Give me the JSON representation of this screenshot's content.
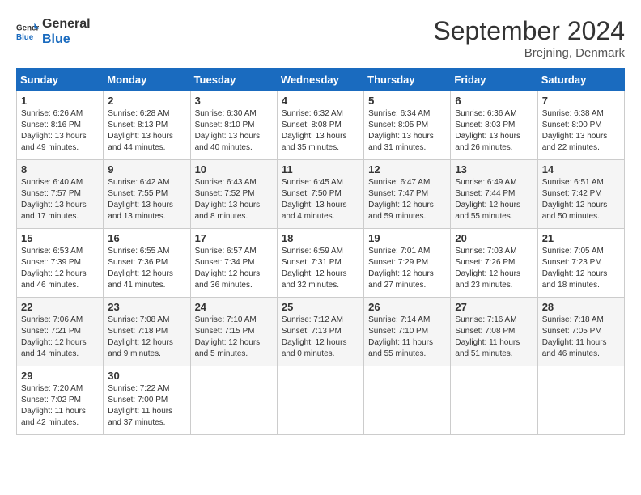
{
  "header": {
    "logo_line1": "General",
    "logo_line2": "Blue",
    "month_title": "September 2024",
    "location": "Brejning, Denmark"
  },
  "days_of_week": [
    "Sunday",
    "Monday",
    "Tuesday",
    "Wednesday",
    "Thursday",
    "Friday",
    "Saturday"
  ],
  "weeks": [
    [
      {
        "day": 1,
        "lines": [
          "Sunrise: 6:26 AM",
          "Sunset: 8:16 PM",
          "Daylight: 13 hours",
          "and 49 minutes."
        ]
      },
      {
        "day": 2,
        "lines": [
          "Sunrise: 6:28 AM",
          "Sunset: 8:13 PM",
          "Daylight: 13 hours",
          "and 44 minutes."
        ]
      },
      {
        "day": 3,
        "lines": [
          "Sunrise: 6:30 AM",
          "Sunset: 8:10 PM",
          "Daylight: 13 hours",
          "and 40 minutes."
        ]
      },
      {
        "day": 4,
        "lines": [
          "Sunrise: 6:32 AM",
          "Sunset: 8:08 PM",
          "Daylight: 13 hours",
          "and 35 minutes."
        ]
      },
      {
        "day": 5,
        "lines": [
          "Sunrise: 6:34 AM",
          "Sunset: 8:05 PM",
          "Daylight: 13 hours",
          "and 31 minutes."
        ]
      },
      {
        "day": 6,
        "lines": [
          "Sunrise: 6:36 AM",
          "Sunset: 8:03 PM",
          "Daylight: 13 hours",
          "and 26 minutes."
        ]
      },
      {
        "day": 7,
        "lines": [
          "Sunrise: 6:38 AM",
          "Sunset: 8:00 PM",
          "Daylight: 13 hours",
          "and 22 minutes."
        ]
      }
    ],
    [
      {
        "day": 8,
        "lines": [
          "Sunrise: 6:40 AM",
          "Sunset: 7:57 PM",
          "Daylight: 13 hours",
          "and 17 minutes."
        ]
      },
      {
        "day": 9,
        "lines": [
          "Sunrise: 6:42 AM",
          "Sunset: 7:55 PM",
          "Daylight: 13 hours",
          "and 13 minutes."
        ]
      },
      {
        "day": 10,
        "lines": [
          "Sunrise: 6:43 AM",
          "Sunset: 7:52 PM",
          "Daylight: 13 hours",
          "and 8 minutes."
        ]
      },
      {
        "day": 11,
        "lines": [
          "Sunrise: 6:45 AM",
          "Sunset: 7:50 PM",
          "Daylight: 13 hours",
          "and 4 minutes."
        ]
      },
      {
        "day": 12,
        "lines": [
          "Sunrise: 6:47 AM",
          "Sunset: 7:47 PM",
          "Daylight: 12 hours",
          "and 59 minutes."
        ]
      },
      {
        "day": 13,
        "lines": [
          "Sunrise: 6:49 AM",
          "Sunset: 7:44 PM",
          "Daylight: 12 hours",
          "and 55 minutes."
        ]
      },
      {
        "day": 14,
        "lines": [
          "Sunrise: 6:51 AM",
          "Sunset: 7:42 PM",
          "Daylight: 12 hours",
          "and 50 minutes."
        ]
      }
    ],
    [
      {
        "day": 15,
        "lines": [
          "Sunrise: 6:53 AM",
          "Sunset: 7:39 PM",
          "Daylight: 12 hours",
          "and 46 minutes."
        ]
      },
      {
        "day": 16,
        "lines": [
          "Sunrise: 6:55 AM",
          "Sunset: 7:36 PM",
          "Daylight: 12 hours",
          "and 41 minutes."
        ]
      },
      {
        "day": 17,
        "lines": [
          "Sunrise: 6:57 AM",
          "Sunset: 7:34 PM",
          "Daylight: 12 hours",
          "and 36 minutes."
        ]
      },
      {
        "day": 18,
        "lines": [
          "Sunrise: 6:59 AM",
          "Sunset: 7:31 PM",
          "Daylight: 12 hours",
          "and 32 minutes."
        ]
      },
      {
        "day": 19,
        "lines": [
          "Sunrise: 7:01 AM",
          "Sunset: 7:29 PM",
          "Daylight: 12 hours",
          "and 27 minutes."
        ]
      },
      {
        "day": 20,
        "lines": [
          "Sunrise: 7:03 AM",
          "Sunset: 7:26 PM",
          "Daylight: 12 hours",
          "and 23 minutes."
        ]
      },
      {
        "day": 21,
        "lines": [
          "Sunrise: 7:05 AM",
          "Sunset: 7:23 PM",
          "Daylight: 12 hours",
          "and 18 minutes."
        ]
      }
    ],
    [
      {
        "day": 22,
        "lines": [
          "Sunrise: 7:06 AM",
          "Sunset: 7:21 PM",
          "Daylight: 12 hours",
          "and 14 minutes."
        ]
      },
      {
        "day": 23,
        "lines": [
          "Sunrise: 7:08 AM",
          "Sunset: 7:18 PM",
          "Daylight: 12 hours",
          "and 9 minutes."
        ]
      },
      {
        "day": 24,
        "lines": [
          "Sunrise: 7:10 AM",
          "Sunset: 7:15 PM",
          "Daylight: 12 hours",
          "and 5 minutes."
        ]
      },
      {
        "day": 25,
        "lines": [
          "Sunrise: 7:12 AM",
          "Sunset: 7:13 PM",
          "Daylight: 12 hours",
          "and 0 minutes."
        ]
      },
      {
        "day": 26,
        "lines": [
          "Sunrise: 7:14 AM",
          "Sunset: 7:10 PM",
          "Daylight: 11 hours",
          "and 55 minutes."
        ]
      },
      {
        "day": 27,
        "lines": [
          "Sunrise: 7:16 AM",
          "Sunset: 7:08 PM",
          "Daylight: 11 hours",
          "and 51 minutes."
        ]
      },
      {
        "day": 28,
        "lines": [
          "Sunrise: 7:18 AM",
          "Sunset: 7:05 PM",
          "Daylight: 11 hours",
          "and 46 minutes."
        ]
      }
    ],
    [
      {
        "day": 29,
        "lines": [
          "Sunrise: 7:20 AM",
          "Sunset: 7:02 PM",
          "Daylight: 11 hours",
          "and 42 minutes."
        ]
      },
      {
        "day": 30,
        "lines": [
          "Sunrise: 7:22 AM",
          "Sunset: 7:00 PM",
          "Daylight: 11 hours",
          "and 37 minutes."
        ]
      },
      {
        "day": null,
        "lines": []
      },
      {
        "day": null,
        "lines": []
      },
      {
        "day": null,
        "lines": []
      },
      {
        "day": null,
        "lines": []
      },
      {
        "day": null,
        "lines": []
      }
    ]
  ]
}
